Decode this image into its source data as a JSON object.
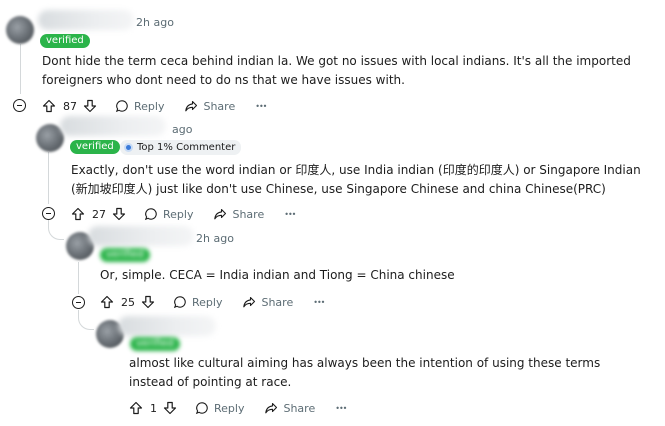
{
  "comments": [
    {
      "time": "2h ago",
      "badge": "verified",
      "text": "Dont hide the term ceca behind indian la. We got no issues with local indians. It's all the imported foreigners who dont need to do ns that we have issues with.",
      "votes": "87",
      "reply_label": "Reply",
      "share_label": "Share",
      "more_label": "•••"
    },
    {
      "time": "ago",
      "badge": "verified",
      "flair": "Top 1% Commenter",
      "text": "Exactly, don't use the word indian or 印度人, use India indian (印度的印度人) or Singapore Indian (新加坡印度人) just like don't use Chinese, use Singapore Chinese and china Chinese(PRC)",
      "votes": "27",
      "reply_label": "Reply",
      "share_label": "Share",
      "more_label": "•••"
    },
    {
      "time": "2h ago",
      "badge": "verified",
      "text": "Or, simple. CECA = India indian and Tiong = China chinese",
      "votes": "25",
      "reply_label": "Reply",
      "share_label": "Share",
      "more_label": "•••"
    },
    {
      "time": "",
      "badge": "verified",
      "text": "almost like cultural aiming has always been the intention of using these terms instead of pointing at race.",
      "votes": "1",
      "reply_label": "Reply",
      "share_label": "Share",
      "more_label": "•••"
    }
  ],
  "icons": [
    "upvote-icon",
    "downvote-icon",
    "reply-bubble-icon",
    "share-arrow-icon",
    "more-dots-icon",
    "collapse-icon",
    "commenter-award-icon"
  ],
  "colors": {
    "verified": "#2bb44a",
    "meta": "#5c6c74",
    "thread": "#d4d8da"
  }
}
